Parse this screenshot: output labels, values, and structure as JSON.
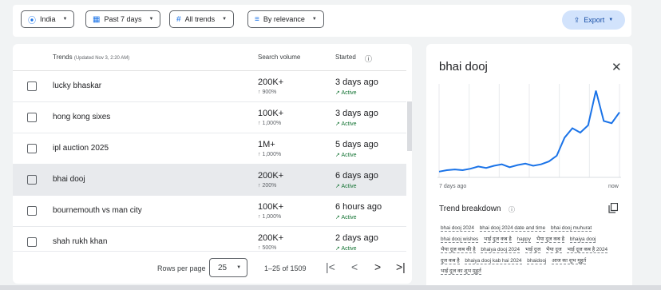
{
  "filters": {
    "country": "India",
    "period": "Past 7 days",
    "category": "All trends",
    "sort": "By relevance",
    "export_label": "Export"
  },
  "table": {
    "col_trends": "Trends",
    "updated": "(Updated Nov 3, 2:20 AM)",
    "col_volume": "Search volume",
    "col_started": "Started",
    "rows": [
      {
        "name": "lucky bhaskar",
        "volume": "200K+",
        "change": "900%",
        "started": "3 days ago",
        "status": "Active"
      },
      {
        "name": "hong kong sixes",
        "volume": "100K+",
        "change": "1,000%",
        "started": "3 days ago",
        "status": "Active"
      },
      {
        "name": "ipl auction 2025",
        "volume": "1M+",
        "change": "1,000%",
        "started": "5 days ago",
        "status": "Active"
      },
      {
        "name": "bhai dooj",
        "volume": "200K+",
        "change": "200%",
        "started": "6 days ago",
        "status": "Active"
      },
      {
        "name": "bournemouth vs man city",
        "volume": "100K+",
        "change": "1,000%",
        "started": "6 hours ago",
        "status": "Active"
      },
      {
        "name": "shah rukh khan",
        "volume": "200K+",
        "change": "500%",
        "started": "2 days ago",
        "status": "Active"
      }
    ],
    "rows_per_page_label": "Rows per page",
    "rows_per_page": "25",
    "range": "1–25 of 1509"
  },
  "detail": {
    "title": "bhai dooj",
    "x_start": "7 days ago",
    "x_end": "now",
    "breakdown_title": "Trend breakdown",
    "tags": [
      "bhai dooj 2024",
      "bhai dooj 2024 date and time",
      "bhai dooj muhurat",
      "bhai dooj wishes",
      "भाई दूज कब है",
      "happy",
      "भैया दूज कब है",
      "bhaiya dooj",
      "भैया दूज कब की है",
      "bhaiya dooj 2024",
      "भाई दूज",
      "भैया दूज",
      "भाई दूज कब है 2024",
      "दूज कब है",
      "bhaiya dooj kab hai 2024",
      "bhaidooj",
      "आज का शुभ मुहूर्त",
      "भाई दूज का शुभ मुहूर्त"
    ]
  },
  "chart_data": {
    "type": "line",
    "series": [
      {
        "values": [
          8,
          10,
          11,
          10,
          12,
          15,
          13,
          16,
          18,
          14,
          17,
          19,
          16,
          18,
          22,
          30,
          55,
          68,
          62,
          72,
          120,
          78,
          75,
          90
        ]
      }
    ],
    "xlabel": "",
    "ylabel": "",
    "x_range": [
      "7 days ago",
      "now"
    ],
    "grid": true,
    "colors": {
      "line": "#1a73e8"
    }
  }
}
